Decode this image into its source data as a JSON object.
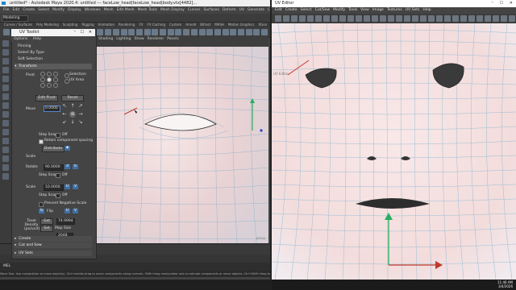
{
  "maya": {
    "title": "untitled* - Autodesk Maya 2020.4: untitled  ---  faceLow_head|faceLow_head|body.vtx[4482]...",
    "menus": [
      "File",
      "Edit",
      "Create",
      "Select",
      "Modify",
      "Display",
      "Windows",
      "Mesh",
      "Edit Mesh",
      "Mesh Tools",
      "Mesh Display",
      "Curves",
      "Surfaces",
      "Deform",
      "UV",
      "Generate",
      "Cache",
      "Arnold",
      "Help"
    ],
    "mode": "Modeling",
    "shelf_tabs": [
      "Curves / Surfaces",
      "Poly Modeling",
      "Sculpting",
      "Rigging",
      "Animation",
      "Rendering",
      "FX",
      "FX Caching",
      "Custom",
      "Arnold",
      "Bifrost",
      "MASH",
      "Motion Graphics",
      "XGen"
    ],
    "viewport_menus": [
      "Shading",
      "Lighting",
      "Show",
      "Renderer",
      "Panels"
    ],
    "viewport_label": "persp",
    "mel_label": "MEL",
    "help_line": "Move Tool: Use manipulator to move object(s). Ctrl+middle-drag to move components along normals. Shift+drag manipulator axis to extrude components or move objects. Ctrl+Shift+drag to constrain movement to a connected edge."
  },
  "uv_toolkit": {
    "title": "UV Toolkit",
    "menus": [
      "Options",
      "Help"
    ],
    "pinning_label": "Pinning",
    "select_by_type_label": "Select By Type",
    "soft_selection_label": "Soft Selection",
    "transform_label": "Transform",
    "pivot_label": "Pivot",
    "selection_label": "Selection",
    "uv_area_label": "UV Area",
    "edit_pivot_label": "Edit Pivot",
    "reset_label": "Reset",
    "move_label": "Move",
    "move_value": "0.0000",
    "step_snap_label": "Step Snap",
    "step_snap_value": "Off",
    "retain_spacing_label": "Retain component spacing",
    "distribute_label": "Distribute",
    "scale_section_label": "Scale",
    "rotate_label": "Rotate",
    "rotate_value": "90.0000",
    "scale_label": "Scale",
    "scale_value": "10.0000",
    "u_label": "U",
    "v_label": "V",
    "prevent_negative_label": "Prevent Negative Scale",
    "flip_label": "Flip",
    "texel_label": "Texel Density (px/unit)",
    "get_label": "Get",
    "texel_value": "74.9994",
    "set_label": "Set",
    "map_size_label": "Map Size",
    "map_size_value": "2048",
    "create_label": "Create",
    "cut_sew_label": "Cut and Sew",
    "uv_sets_label": "UV Sets"
  },
  "uv_editor": {
    "title": "UV Editor",
    "menus": [
      "Edit",
      "Create",
      "Select",
      "Cut/Sew",
      "Modify",
      "Tools",
      "View",
      "Image",
      "Textures",
      "UV Sets",
      "Help"
    ],
    "view_label": "UV Editor"
  },
  "taskbar": {
    "time": "11:46 AM",
    "date": "3/4/2026"
  },
  "colors": {
    "panel": "#444444",
    "accent": "#3d6fa8",
    "mesh_wire": "#7fb0d0",
    "skin": "#f1dada"
  }
}
